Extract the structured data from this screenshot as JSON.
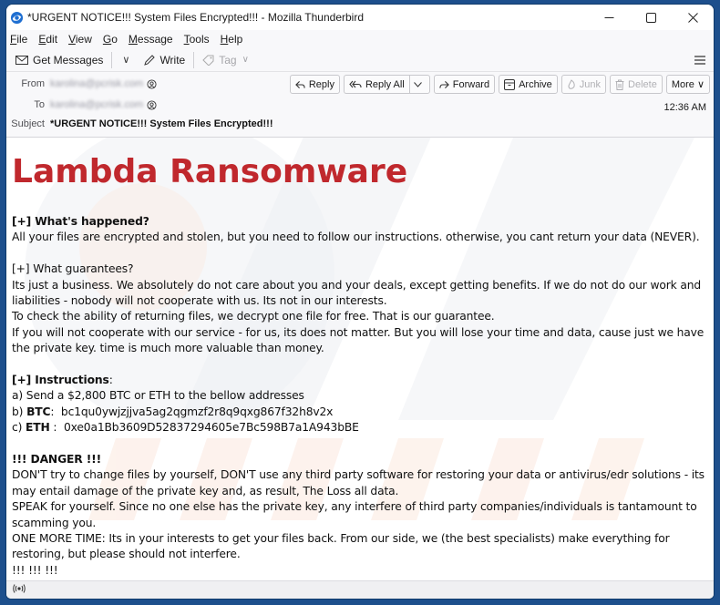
{
  "window": {
    "title": "*URGENT NOTICE!!! System Files Encrypted!!! - Mozilla Thunderbird",
    "controls": {
      "minimize": "—",
      "maximize": "☐",
      "close": "✕"
    }
  },
  "menubar": {
    "items": [
      {
        "key": "F",
        "rest": "ile"
      },
      {
        "key": "E",
        "rest": "dit"
      },
      {
        "key": "V",
        "rest": "iew"
      },
      {
        "key": "G",
        "rest": "o"
      },
      {
        "key": "M",
        "rest": "essage"
      },
      {
        "key": "T",
        "rest": "ools"
      },
      {
        "key": "H",
        "rest": "elp"
      }
    ]
  },
  "toolbar": {
    "get_messages": "Get Messages",
    "write": "Write",
    "tag": "Tag",
    "dropdown_glyph": "∨"
  },
  "header": {
    "from_label": "From",
    "from_value": "karolina@pcrisk.com",
    "to_label": "To",
    "to_value": "karolina@pcrisk.com",
    "subject_label": "Subject",
    "subject_value": "*URGENT NOTICE!!! System Files Encrypted!!!",
    "date": "12:36 AM",
    "actions": {
      "reply": "Reply",
      "reply_all": "Reply All",
      "forward": "Forward",
      "archive": "Archive",
      "junk": "Junk",
      "delete": "Delete",
      "more": "More ∨"
    }
  },
  "message": {
    "heading": "Lambda Ransomware",
    "section1_title": "[+] What's happened?",
    "section1_body": "All your files are encrypted and stolen, but you need to follow our instructions. otherwise, you cant return your data (NEVER).",
    "section2_title": "[+] What guarantees?",
    "section2_lines": [
      "Its just a business. We absolutely do not care about you and your deals, except getting benefits. If we do not do our work and liabilities - nobody will not cooperate with us. Its not in our interests.",
      "To check the ability of returning files, we decrypt one file for free. That is our guarantee.",
      "If you will not cooperate with our service - for us, its does not matter. But you will lose your time and data, cause just we have the private key. time is much more valuable than money."
    ],
    "section3_title": "[+] Instructions",
    "section3_colon": ":",
    "instr_a": "a) Send a $2,800 BTC or ETH to the bellow addresses",
    "instr_b_prefix": "b) ",
    "instr_b_label": "BTC",
    "instr_b_sep": ":  ",
    "btc_address": "bc1qu0ywjzjjva5ag2qgmzf2r8q9qxg867f32h8v2x",
    "instr_c_prefix": "c) ",
    "instr_c_label": "ETH",
    "instr_c_sep": " :  ",
    "eth_address": "0xe0a1Bb3609D52837294605e7Bc598B7a1A943bBE",
    "danger_title": "!!! DANGER !!!",
    "danger_lines": [
      "DON'T try to change files by yourself, DON'T use any third party software for restoring your data or antivirus/edr solutions - its may entail damage of the private key and, as result, The Loss all data.",
      "SPEAK for yourself. Since no one else has the private key, any interfere of third party companies/individuals is tantamount to scamming you.",
      "ONE MORE TIME: Its in your interests to get your files back. From our side, we (the best specialists) make everything for restoring, but please should not interfere.",
      "!!! !!! !!!"
    ]
  },
  "colors": {
    "heading_red": "#c0282d",
    "window_frame": "#1d4f8c"
  }
}
